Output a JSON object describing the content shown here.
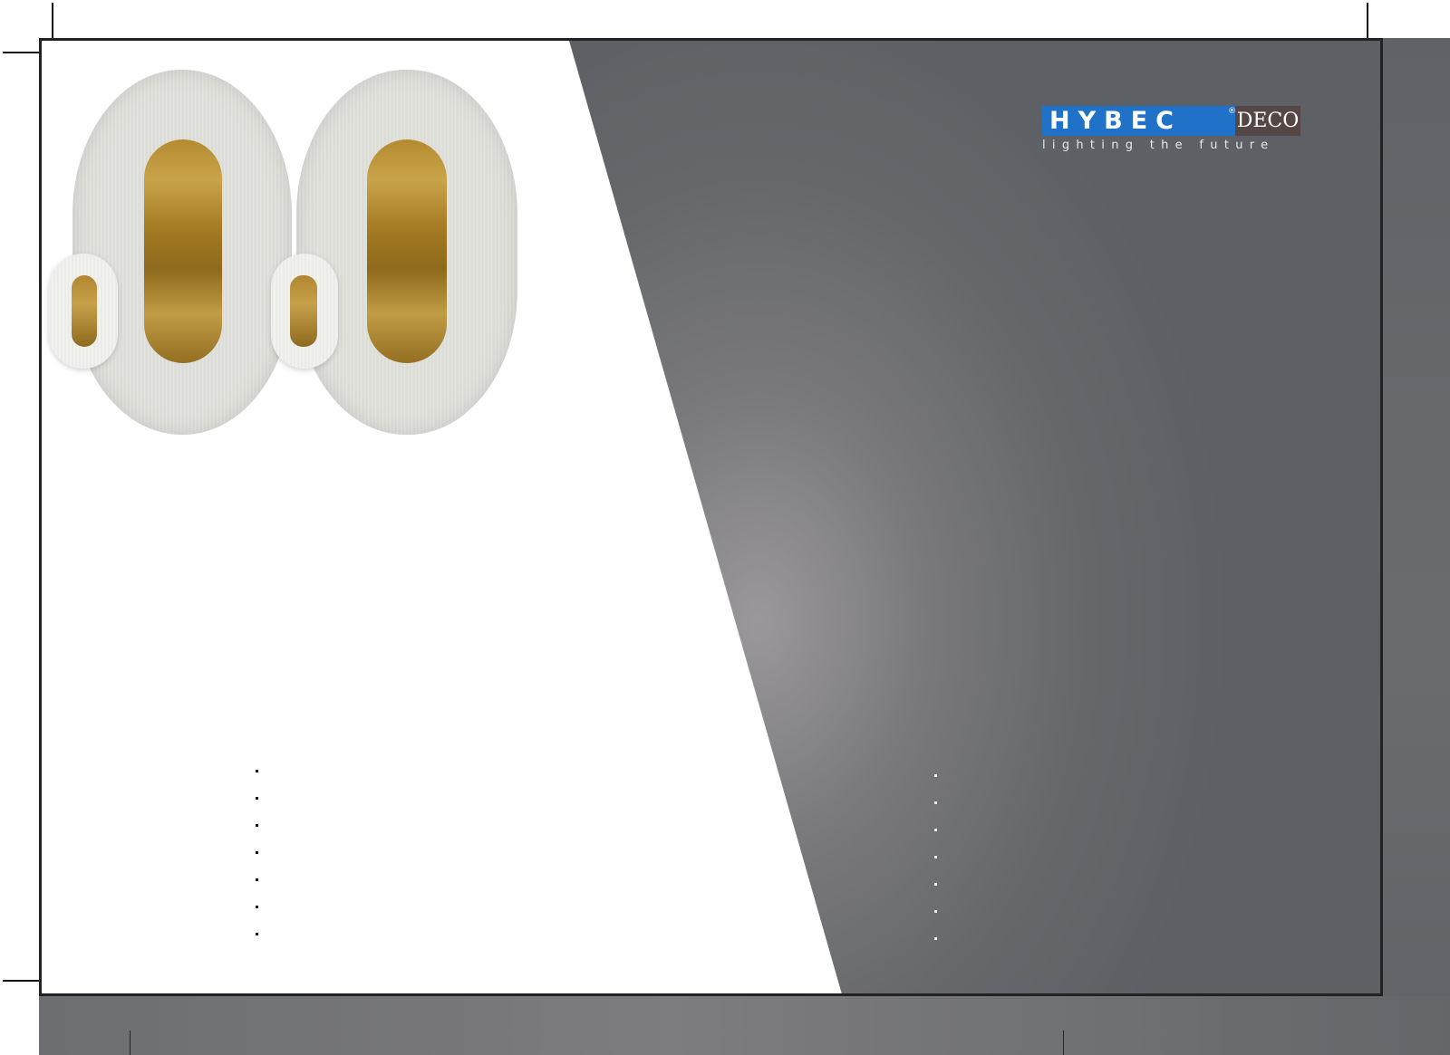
{
  "brand": {
    "name": "HYBEC",
    "registered_mark": "®",
    "suffix": "DECO",
    "tagline": "lighting the future",
    "colors": {
      "primary_blue": "#1f72c7",
      "deco_brown": "#544745"
    }
  },
  "panel": {
    "dark_gray": "#5d6165",
    "light_gray": "#9a989b"
  },
  "product_image": {
    "description_icon": "wall-lamp-icon",
    "count": 2
  },
  "bullet_markers": {
    "left_count": 7,
    "right_count": 7
  }
}
